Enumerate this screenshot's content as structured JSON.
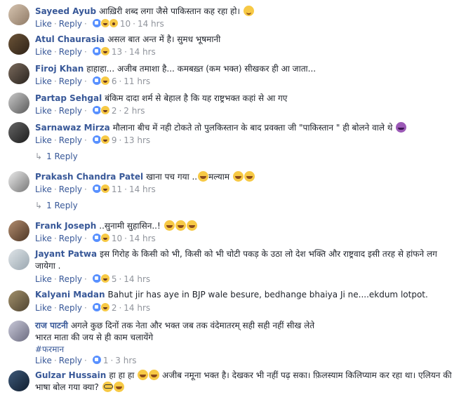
{
  "actions": {
    "like": "Like",
    "reply": "Reply"
  },
  "comments": [
    {
      "author": "Sayeed Ayub",
      "text": "आख़िरी शब्द लगा जैसे पाकिस्तान कह रहा हो।",
      "reaction_count": "10",
      "time": "14 hrs",
      "reactions": [
        "like-icon",
        "haha-icon",
        "wow-icon"
      ],
      "text_emojis": [
        "smile-emoji"
      ]
    },
    {
      "author": "Atul Chaurasia",
      "text": "असल बात अन्त में है। सुमध भूषमानी",
      "reaction_count": "13",
      "time": "14 hrs",
      "reactions": [
        "like-icon",
        "haha-icon"
      ]
    },
    {
      "author": "Firoj Khan",
      "text": "हाहाहा... अजीब तमाशा है... कमबख़्त (कम भक्त) सीखकर ही आ जाता...",
      "reaction_count": "6",
      "time": "11 hrs",
      "reactions": [
        "like-icon",
        "haha-icon"
      ]
    },
    {
      "author": "Partap Sehgal",
      "text": "बंकिम दादा शर्म से बेहाल है कि यह राष्ट्रभक्त कहां से आ गए",
      "reaction_count": "2",
      "time": "2 hrs",
      "reactions": [
        "like-icon",
        "haha-icon"
      ]
    },
    {
      "author": "Sarnawaz Mirza",
      "text": "मौलाना बीच में नही टोकते तो पुलकिस्तान के बाद प्रवक्ता जी \"पाकिस्तान \" ही बोलने वाले थे",
      "reaction_count": "9",
      "time": "13 hrs",
      "reactions": [
        "like-icon",
        "haha-icon"
      ],
      "text_emojis": [
        "devil-emoji"
      ],
      "replies": "1 Reply"
    },
    {
      "author": "Prakash Chandra Patel",
      "text": "खाना पच गया ..",
      "text_after": "मल्याम",
      "reaction_count": "11",
      "time": "14 hrs",
      "reactions": [
        "like-icon",
        "haha-icon"
      ],
      "replies": "1 Reply"
    },
    {
      "author": "Frank Joseph",
      "text": "..सुनामी सुहासिन..!",
      "reaction_count": "10",
      "time": "14 hrs",
      "reactions": [
        "like-icon",
        "haha-icon"
      ]
    },
    {
      "author": "Jayant Patwa",
      "text": "इस गिरोह के किसी को भी, किसी को भी चोटी पकड़ के उठा लो देश भक्ति और राष्ट्रवाद इसी तरह से हांफने लग",
      "text_line2": "जायेगा .",
      "reaction_count": "5",
      "time": "14 hrs",
      "reactions": [
        "like-icon",
        "haha-icon"
      ]
    },
    {
      "author": "Kalyani Madan",
      "text": "Bahut jir has aye in BJP wale besure, bedhange bhaiya Ji ne....ekdum lotpot.",
      "reaction_count": "2",
      "time": "14 hrs",
      "reactions": [
        "like-icon",
        "haha-icon"
      ]
    },
    {
      "author": "राज पाटनी",
      "text": "अगले कुछ दिनों तक नेता और भक्त जब तक वंदेमातरम् सही सही नहीं सीख लेते",
      "text_line2": "भारत माता की जय से ही काम चलायेंगे",
      "hashtag": "#फरमान",
      "reaction_count": "1",
      "time": "3 hrs",
      "reactions": [
        "like-icon"
      ]
    },
    {
      "author": "Gulzar Hussain",
      "text": "हा हा हा",
      "text_after": "अजीब नमूना भक्त है। देखकर भी नहीं पढ़ सका। फ़िलस्याम किलिप्याम कर रहा था। एलियन की",
      "text_line2": "भाषा बोल गया क्या?",
      "reaction_count": "",
      "time": "",
      "reactions": []
    }
  ]
}
